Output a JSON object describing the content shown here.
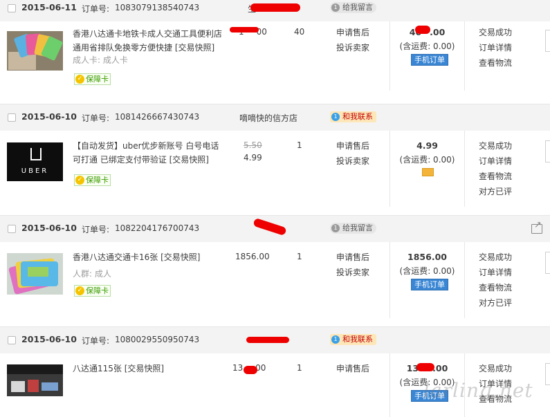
{
  "labels": {
    "order_no": "订单号:",
    "guarantee": "保障卡",
    "shipping_fee": "(含运费: 0.00)",
    "mobile_order": "手机订单"
  },
  "orders": [
    {
      "date": "2015-06-11",
      "order_no": "1083079138540743",
      "shop": "生",
      "msg": "给我留言",
      "title": "香港八达通卡地铁卡成人交通工具便利店通用省排队免换零方便快捷 [交易快照]",
      "attr": "成人卡: 成人卡",
      "price": "1",
      "price_suffix": "00",
      "qty": "40",
      "services": [
        "申请售后",
        "投诉卖家"
      ],
      "total": "46",
      "total_suffix": ".00",
      "ops": [
        "交易成功",
        "订单详情",
        "查看物流"
      ]
    },
    {
      "date": "2015-06-10",
      "order_no": "1081426667430743",
      "shop": "嘀嘀快的信方店",
      "msg": "和我联系",
      "title": "【自动发货】uber优步新账号 白号电话可打通 已绑定支付带验证 [交易快照]",
      "old_price": "5.50",
      "price": "4.99",
      "qty": "1",
      "services": [
        "申请售后",
        "投诉卖家"
      ],
      "total": "4.99",
      "ops": [
        "交易成功",
        "订单详情",
        "查看物流",
        "对方已评"
      ],
      "logo_text": "UBER"
    },
    {
      "date": "2015-06-10",
      "order_no": "1082204176700743",
      "shop": "",
      "msg": "给我留言",
      "title": "香港八达通交通卡16张 [交易快照]",
      "attr": "人群: 成人",
      "price": "1856.00",
      "qty": "1",
      "services": [
        "申请售后",
        "投诉卖家"
      ],
      "total": "1856.00",
      "ops": [
        "交易成功",
        "订单详情",
        "查看物流",
        "对方已评"
      ]
    },
    {
      "date": "2015-06-10",
      "order_no": "1080029550950743",
      "shop": "",
      "msg": "和我联系",
      "title": "八达通115张 [交易快照]",
      "price": "13",
      "price_suffix": ".00",
      "qty": "1",
      "services": [
        "申请售后"
      ],
      "total": "13",
      "total_suffix": ".00",
      "ops": [
        "交易成功",
        "订单详情",
        "查看物流"
      ]
    }
  ],
  "watermark": "larling.net"
}
